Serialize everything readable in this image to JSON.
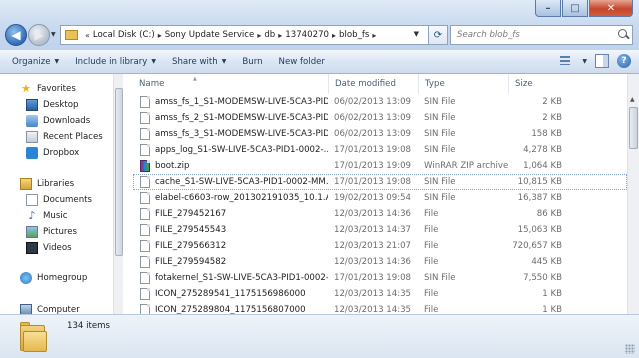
{
  "address": {
    "crumbs": [
      "Local Disk (C:)",
      "Sony Update Service",
      "db",
      "13740270",
      "blob_fs"
    ]
  },
  "search": {
    "placeholder": "Search blob_fs"
  },
  "toolbar": {
    "organize": "Organize",
    "include_in_library": "Include in library",
    "share_with": "Share with",
    "burn": "Burn",
    "new_folder": "New folder"
  },
  "nav": {
    "favorites": "Favorites",
    "desktop": "Desktop",
    "downloads": "Downloads",
    "recent_places": "Recent Places",
    "dropbox": "Dropbox",
    "libraries": "Libraries",
    "documents": "Documents",
    "music": "Music",
    "pictures": "Pictures",
    "videos": "Videos",
    "homegroup": "Homegroup",
    "computer": "Computer"
  },
  "columns": {
    "name": "Name",
    "date": "Date modified",
    "type": "Type",
    "size": "Size"
  },
  "files": [
    {
      "name": "amss_fs_1_S1-MODEMSW-LIVE-5CA3-PID...",
      "date": "06/02/2013 13:09",
      "type": "SIN File",
      "size": "2 KB",
      "icon": "file-icon"
    },
    {
      "name": "amss_fs_2_S1-MODEMSW-LIVE-5CA3-PID...",
      "date": "06/02/2013 13:09",
      "type": "SIN File",
      "size": "2 KB",
      "icon": "file-icon"
    },
    {
      "name": "amss_fs_3_S1-MODEMSW-LIVE-5CA3-PID...",
      "date": "06/02/2013 13:09",
      "type": "SIN File",
      "size": "158 KB",
      "icon": "file-icon"
    },
    {
      "name": "apps_log_S1-SW-LIVE-5CA3-PID1-0002-...",
      "date": "17/01/2013 19:08",
      "type": "SIN File",
      "size": "4,278 KB",
      "icon": "file-icon"
    },
    {
      "name": "boot.zip",
      "date": "17/01/2013 19:09",
      "type": "WinRAR ZIP archive",
      "size": "1,064 KB",
      "icon": "zip-icon"
    },
    {
      "name": "cache_S1-SW-LIVE-5CA3-PID1-0002-MM...",
      "date": "17/01/2013 19:08",
      "type": "SIN File",
      "size": "10,815 KB",
      "icon": "file-icon",
      "selected": true
    },
    {
      "name": "elabel-c6603-row_201302191035_10.1.A.1....",
      "date": "19/02/2013 09:54",
      "type": "SIN File",
      "size": "16,387 KB",
      "icon": "file-icon"
    },
    {
      "name": "FILE_279452167",
      "date": "12/03/2013 14:36",
      "type": "File",
      "size": "86 KB",
      "icon": "file-icon"
    },
    {
      "name": "FILE_279545543",
      "date": "12/03/2013 14:37",
      "type": "File",
      "size": "15,063 KB",
      "icon": "file-icon"
    },
    {
      "name": "FILE_279566312",
      "date": "12/03/2013 21:07",
      "type": "File",
      "size": "720,657 KB",
      "icon": "file-icon"
    },
    {
      "name": "FILE_279594582",
      "date": "12/03/2013 14:36",
      "type": "File",
      "size": "445 KB",
      "icon": "file-icon"
    },
    {
      "name": "fotakernel_S1-SW-LIVE-5CA3-PID1-0002-...",
      "date": "17/01/2013 19:08",
      "type": "SIN File",
      "size": "7,550 KB",
      "icon": "file-icon"
    },
    {
      "name": "ICON_275289541_1175156986000",
      "date": "12/03/2013 14:35",
      "type": "File",
      "size": "1 KB",
      "icon": "file-icon"
    },
    {
      "name": "ICON_275289804_1175156807000",
      "date": "12/03/2013 14:35",
      "type": "File",
      "size": "1 KB",
      "icon": "file-icon"
    }
  ],
  "status": {
    "item_count": "134 items"
  }
}
